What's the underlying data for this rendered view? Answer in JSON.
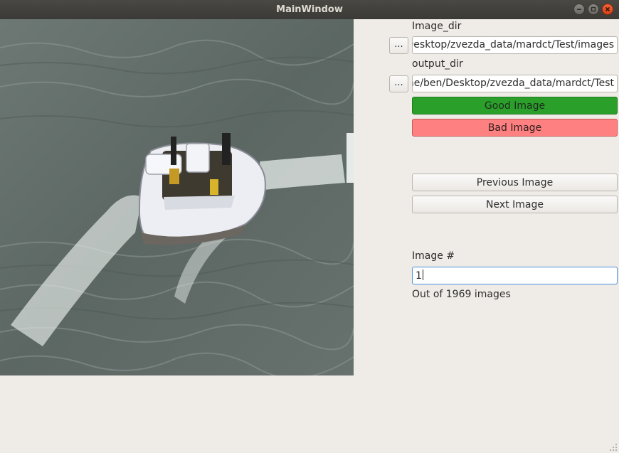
{
  "window": {
    "title": "MainWindow",
    "controls": [
      "minimize-icon",
      "maximize-icon",
      "close-icon"
    ]
  },
  "image_dir": {
    "label": "Image_dir",
    "value": "Desktop/zvezda_data/mardct/Test/images",
    "browse_label": "..."
  },
  "output_dir": {
    "label": "output_dir",
    "value": "ne/ben/Desktop/zvezda_data/mardct/Test",
    "browse_label": "..."
  },
  "buttons": {
    "good": "Good Image",
    "bad": "Bad Image",
    "previous": "Previous Image",
    "next": "Next Image"
  },
  "image_number": {
    "label": "Image #",
    "value": "1",
    "total_text": "Out of 1969 images"
  },
  "colors": {
    "good": "#2aa02a",
    "bad": "#ff8080",
    "focus": "#4a90d9",
    "titlebar": "#3b3a36"
  }
}
